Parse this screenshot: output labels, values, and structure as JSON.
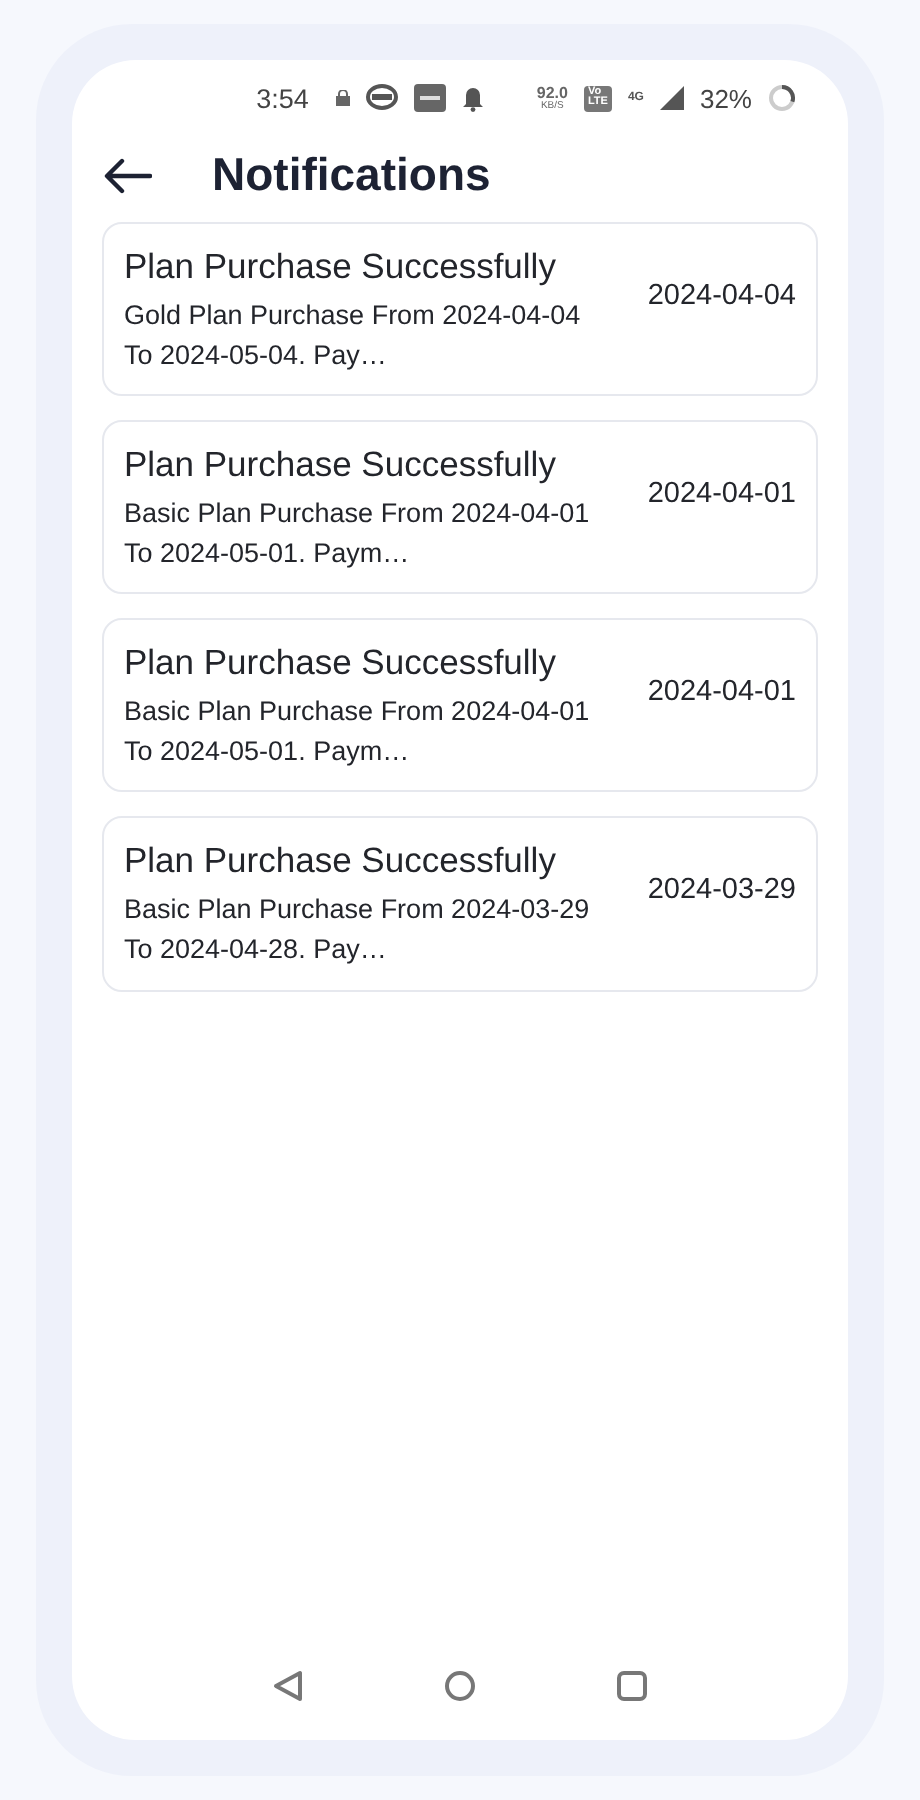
{
  "status_bar": {
    "time": "3:54",
    "network_speed": "92.0",
    "network_unit": "KB/S",
    "volte": "Vo",
    "lte": "LTE",
    "signal_type": "4G",
    "battery": "32%"
  },
  "header": {
    "title": "Notifications"
  },
  "notifications": [
    {
      "title": "Plan Purchase Successfully",
      "message": "Gold Plan Purchase From 2024-04-04 To 2024-05-04. Pay…",
      "date": "2024-04-04"
    },
    {
      "title": "Plan Purchase Successfully",
      "message": "Basic Plan Purchase From 2024-04-01 To 2024-05-01. Paym…",
      "date": "2024-04-01"
    },
    {
      "title": "Plan Purchase Successfully",
      "message": "Basic Plan Purchase From 2024-04-01 To 2024-05-01. Paym…",
      "date": "2024-04-01"
    },
    {
      "title": "Plan Purchase Successfully",
      "message": "Basic Plan Purchase From 2024-03-29 To 2024-04-28. Pay…",
      "date": "2024-03-29"
    }
  ]
}
